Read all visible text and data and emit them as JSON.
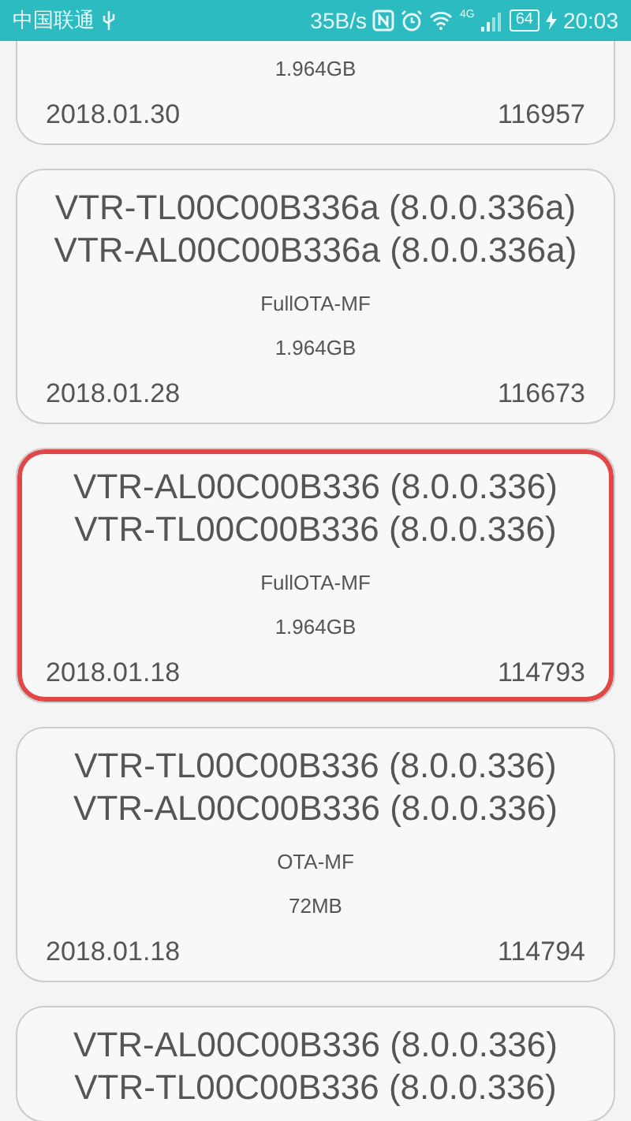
{
  "status_bar": {
    "carrier": "中国联通",
    "speed": "35B/s",
    "network": "4G",
    "battery": "64",
    "time": "20:03"
  },
  "cards": [
    {
      "size": "1.964GB",
      "date": "2018.01.30",
      "number": "116957",
      "highlighted": false
    },
    {
      "titles": [
        "VTR-TL00C00B336a (8.0.0.336a)",
        "VTR-AL00C00B336a (8.0.0.336a)"
      ],
      "type": "FullOTA-MF",
      "size": "1.964GB",
      "date": "2018.01.28",
      "number": "116673",
      "highlighted": false
    },
    {
      "titles": [
        "VTR-AL00C00B336 (8.0.0.336)",
        "VTR-TL00C00B336 (8.0.0.336)"
      ],
      "type": "FullOTA-MF",
      "size": "1.964GB",
      "date": "2018.01.18",
      "number": "114793",
      "highlighted": true
    },
    {
      "titles": [
        "VTR-TL00C00B336 (8.0.0.336)",
        "VTR-AL00C00B336 (8.0.0.336)"
      ],
      "type": "OTA-MF",
      "size": "72MB",
      "date": "2018.01.18",
      "number": "114794",
      "highlighted": false
    },
    {
      "titles": [
        "VTR-AL00C00B336 (8.0.0.336)",
        "VTR-TL00C00B336 (8.0.0.336)"
      ],
      "highlighted": false
    }
  ]
}
